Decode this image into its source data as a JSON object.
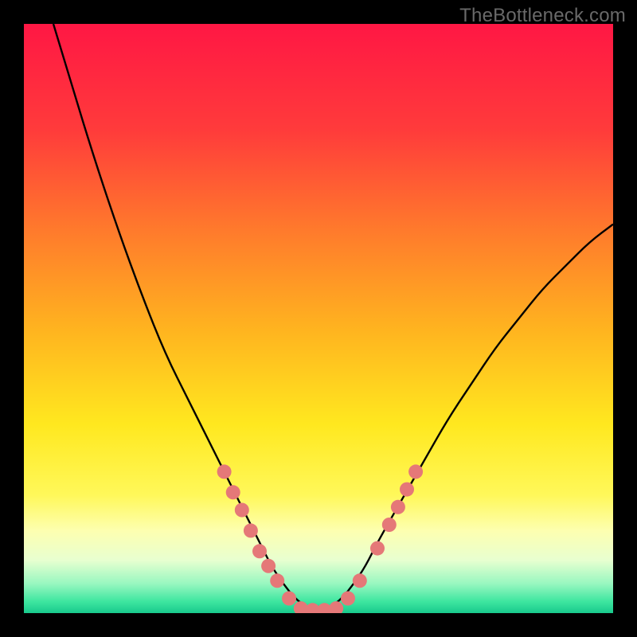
{
  "watermark": "TheBottleneck.com",
  "chart_data": {
    "type": "line",
    "title": "",
    "xlabel": "",
    "ylabel": "",
    "xlim": [
      0,
      100
    ],
    "ylim": [
      0,
      100
    ],
    "grid": false,
    "legend": false,
    "background_gradient": {
      "orientation": "vertical",
      "stops": [
        {
          "offset": 0.0,
          "color": "#ff1744"
        },
        {
          "offset": 0.18,
          "color": "#ff3b3b"
        },
        {
          "offset": 0.35,
          "color": "#ff7a2c"
        },
        {
          "offset": 0.52,
          "color": "#ffb41f"
        },
        {
          "offset": 0.68,
          "color": "#ffe81f"
        },
        {
          "offset": 0.8,
          "color": "#fff85a"
        },
        {
          "offset": 0.86,
          "color": "#fdffb0"
        },
        {
          "offset": 0.91,
          "color": "#e8ffd0"
        },
        {
          "offset": 0.95,
          "color": "#98f7c0"
        },
        {
          "offset": 0.98,
          "color": "#3fe6a0"
        },
        {
          "offset": 1.0,
          "color": "#18c98c"
        }
      ]
    },
    "series": [
      {
        "name": "bottleneck-curve",
        "stroke": "#000000",
        "x": [
          5,
          8,
          12,
          16,
          20,
          24,
          28,
          32,
          35,
          38,
          40,
          42,
          44,
          46,
          48,
          50,
          52,
          54,
          56,
          58,
          60,
          64,
          68,
          72,
          76,
          80,
          84,
          88,
          92,
          96,
          100
        ],
        "values": [
          100,
          90,
          77,
          65,
          54,
          44,
          36,
          28,
          22,
          16,
          12,
          8,
          5,
          2.5,
          1,
          0.5,
          1,
          2.5,
          5,
          8,
          12,
          19,
          26,
          33,
          39,
          45,
          50,
          55,
          59,
          63,
          66
        ]
      }
    ],
    "markers": {
      "name": "highlight-points",
      "shape": "circle",
      "color": "#e57878",
      "radius_px": 9,
      "points": [
        {
          "x": 34,
          "y": 24
        },
        {
          "x": 35.5,
          "y": 20.5
        },
        {
          "x": 37,
          "y": 17.5
        },
        {
          "x": 38.5,
          "y": 14
        },
        {
          "x": 40,
          "y": 10.5
        },
        {
          "x": 41.5,
          "y": 8
        },
        {
          "x": 43,
          "y": 5.5
        },
        {
          "x": 45,
          "y": 2.5
        },
        {
          "x": 47,
          "y": 0.8
        },
        {
          "x": 49,
          "y": 0.5
        },
        {
          "x": 51,
          "y": 0.5
        },
        {
          "x": 53,
          "y": 0.8
        },
        {
          "x": 55,
          "y": 2.5
        },
        {
          "x": 57,
          "y": 5.5
        },
        {
          "x": 60,
          "y": 11
        },
        {
          "x": 62,
          "y": 15
        },
        {
          "x": 63.5,
          "y": 18
        },
        {
          "x": 65,
          "y": 21
        },
        {
          "x": 66.5,
          "y": 24
        }
      ]
    }
  }
}
